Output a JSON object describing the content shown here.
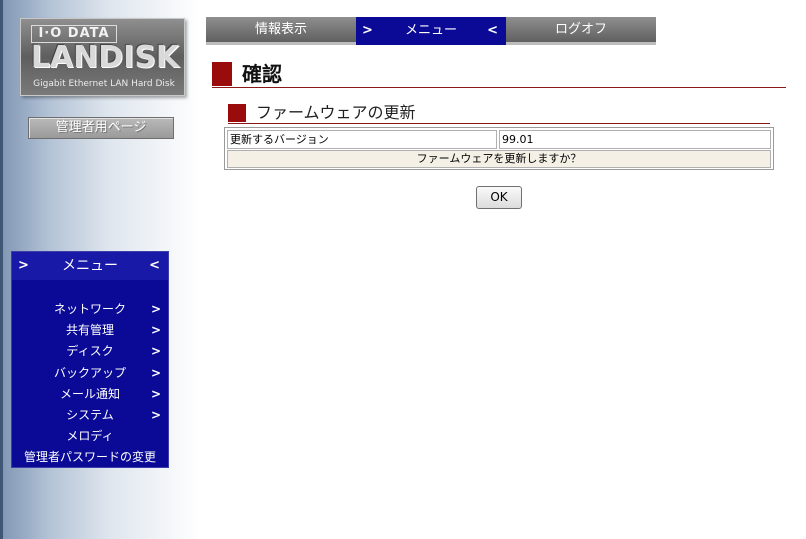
{
  "logo": {
    "brand": "I·O DATA",
    "product": "LANDISK",
    "tagline": "Gigabit Ethernet LAN Hard Disk"
  },
  "sidebar": {
    "admin_button": "管理者用ページ",
    "menu_title": "メニュー",
    "items": [
      {
        "label": "ネットワーク",
        "has_arrow": true
      },
      {
        "label": "共有管理",
        "has_arrow": true
      },
      {
        "label": "ディスク",
        "has_arrow": true
      },
      {
        "label": "バックアップ",
        "has_arrow": true
      },
      {
        "label": "メール通知",
        "has_arrow": true
      },
      {
        "label": "システム",
        "has_arrow": true
      },
      {
        "label": "メロディ",
        "has_arrow": false
      },
      {
        "label": "管理者パスワードの変更",
        "has_arrow": false
      }
    ]
  },
  "top_nav": {
    "tabs": [
      {
        "label": "情報表示",
        "active": false
      },
      {
        "label": "メニュー",
        "active": true
      },
      {
        "label": "ログオフ",
        "active": false
      }
    ]
  },
  "main": {
    "page_title": "確認",
    "section_title": "ファームウェアの更新",
    "table": {
      "label": "更新するバージョン",
      "value": "99.01",
      "message": "ファームウェアを更新しますか？"
    },
    "ok_label": "OK"
  },
  "colors": {
    "nav_blue": "#0a0a96",
    "heading_red": "#9a0c0c",
    "nav_gray": "#6f6f6f"
  },
  "icons": {
    "arrow_right": ">",
    "arrow_left": "<"
  }
}
